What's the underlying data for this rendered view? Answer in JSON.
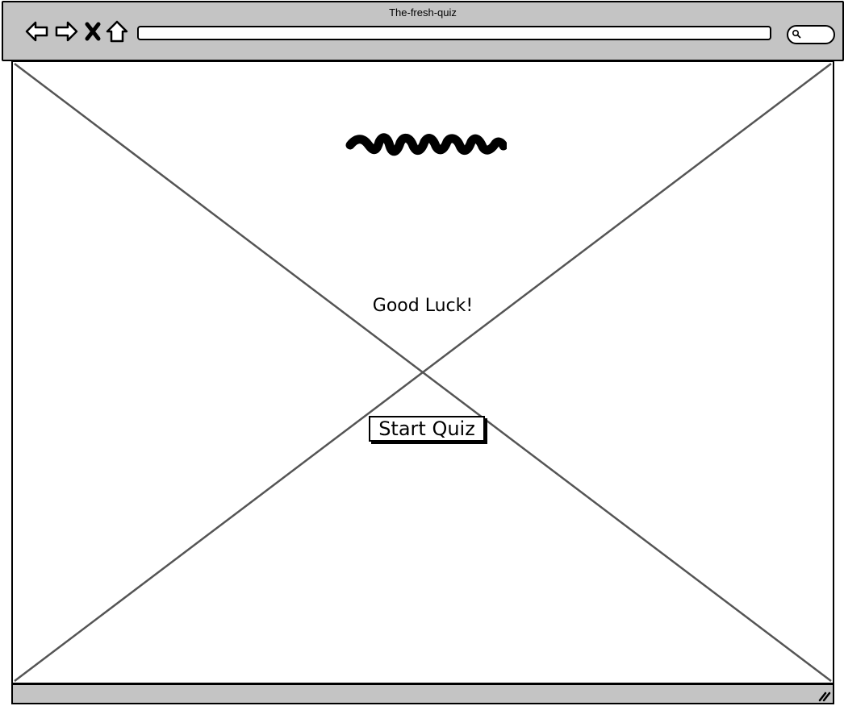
{
  "window": {
    "title": "The-fresh-quiz"
  },
  "toolbar": {
    "back_icon": "arrow-left-icon",
    "forward_icon": "arrow-right-icon",
    "stop_icon": "close-icon",
    "home_icon": "home-icon",
    "search_icon": "search-icon",
    "address_value": ""
  },
  "main": {
    "logo": "logo-scribble",
    "greeting": "Good Luck!",
    "start_label": "Start Quiz"
  },
  "colors": {
    "chrome": "#c4c4c4",
    "border": "#000000",
    "placeholder_lines": "#555555"
  }
}
